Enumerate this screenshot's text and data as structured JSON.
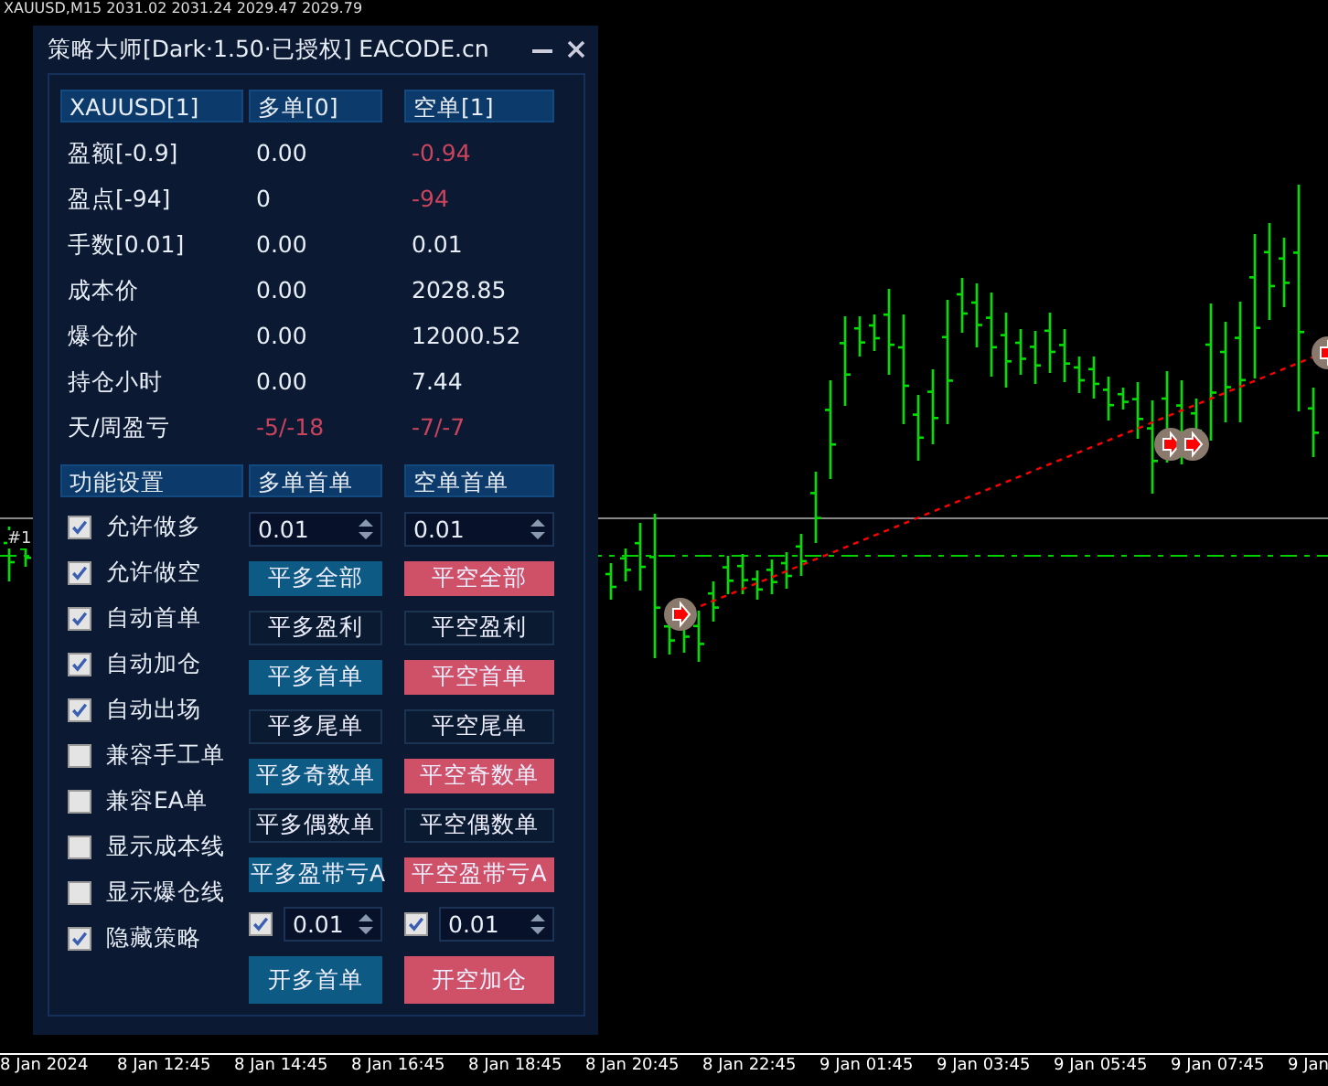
{
  "chart_header": "XAUUSD,M15  2031.02 2031.24 2029.47 2029.79",
  "chart_label": "#1",
  "time_axis": [
    "8 Jan 2024",
    "8 Jan 12:45",
    "8 Jan 14:45",
    "8 Jan 16:45",
    "8 Jan 18:45",
    "8 Jan 20:45",
    "8 Jan 22:45",
    "9 Jan 01:45",
    "9 Jan 03:45",
    "9 Jan 05:45",
    "9 Jan 07:45",
    "9 Jan"
  ],
  "panel": {
    "title": "策略大师[Dark·1.50·已授权] EACODE.cn",
    "columns": [
      "XAUUSD[1]",
      "多单[0]",
      "空单[1]"
    ],
    "rows": [
      {
        "cells": [
          {
            "text": "盈额[-0.9]",
            "loss": false
          },
          {
            "text": "0.00",
            "loss": false
          },
          {
            "text": "-0.94",
            "loss": true
          }
        ]
      },
      {
        "cells": [
          {
            "text": "盈点[-94]",
            "loss": false
          },
          {
            "text": "0",
            "loss": false
          },
          {
            "text": "-94",
            "loss": true
          }
        ]
      },
      {
        "cells": [
          {
            "text": "手数[0.01]",
            "loss": false
          },
          {
            "text": "0.00",
            "loss": false
          },
          {
            "text": "0.01",
            "loss": false
          }
        ]
      },
      {
        "cells": [
          {
            "text": "成本价",
            "loss": false
          },
          {
            "text": "0.00",
            "loss": false
          },
          {
            "text": "2028.85",
            "loss": false
          }
        ]
      },
      {
        "cells": [
          {
            "text": "爆仓价",
            "loss": false
          },
          {
            "text": "0.00",
            "loss": false
          },
          {
            "text": "12000.52",
            "loss": false
          }
        ]
      },
      {
        "cells": [
          {
            "text": "持仓小时",
            "loss": false
          },
          {
            "text": "0.00",
            "loss": false
          },
          {
            "text": "7.44",
            "loss": false
          }
        ]
      },
      {
        "cells": [
          {
            "text": "天/周盈亏",
            "loss": false
          },
          {
            "text": "-5/-18",
            "loss": true
          },
          {
            "text": "-7/-7",
            "loss": true
          }
        ]
      }
    ],
    "settings_header": "功能设置",
    "options": [
      {
        "label": "允许做多",
        "checked": true
      },
      {
        "label": "允许做空",
        "checked": true
      },
      {
        "label": "自动首单",
        "checked": true
      },
      {
        "label": "自动加仓",
        "checked": true
      },
      {
        "label": "自动出场",
        "checked": true
      },
      {
        "label": "兼容手工单",
        "checked": false
      },
      {
        "label": "兼容EA单",
        "checked": false
      },
      {
        "label": "显示成本线",
        "checked": false
      },
      {
        "label": "显示爆仓线",
        "checked": false
      },
      {
        "label": "隐藏策略",
        "checked": true
      }
    ],
    "sides": [
      {
        "color": "#0d5a85",
        "header": "多单首单",
        "lots": "0.01",
        "buttons": [
          {
            "label": "平多全部",
            "kind": "filled"
          },
          {
            "label": "平多盈利",
            "kind": "outline"
          },
          {
            "label": "平多首单",
            "kind": "filled"
          },
          {
            "label": "平多尾单",
            "kind": "outline"
          },
          {
            "label": "平多奇数单",
            "kind": "filled"
          },
          {
            "label": "平多偶数单",
            "kind": "outline"
          },
          {
            "label": "平多盈带亏A",
            "kind": "filled"
          }
        ],
        "extra_checked": true,
        "extra_lots": "0.01",
        "open_button": "开多首单"
      },
      {
        "color": "#cf5168",
        "header": "空单首单",
        "lots": "0.01",
        "buttons": [
          {
            "label": "平空全部",
            "kind": "filled"
          },
          {
            "label": "平空盈利",
            "kind": "outline"
          },
          {
            "label": "平空首单",
            "kind": "filled"
          },
          {
            "label": "平空尾单",
            "kind": "outline"
          },
          {
            "label": "平空奇数单",
            "kind": "filled"
          },
          {
            "label": "平空偶数单",
            "kind": "outline"
          },
          {
            "label": "平空盈带亏A",
            "kind": "filled"
          }
        ],
        "extra_checked": true,
        "extra_lots": "0.01",
        "open_button": "开空加仓"
      }
    ]
  }
}
